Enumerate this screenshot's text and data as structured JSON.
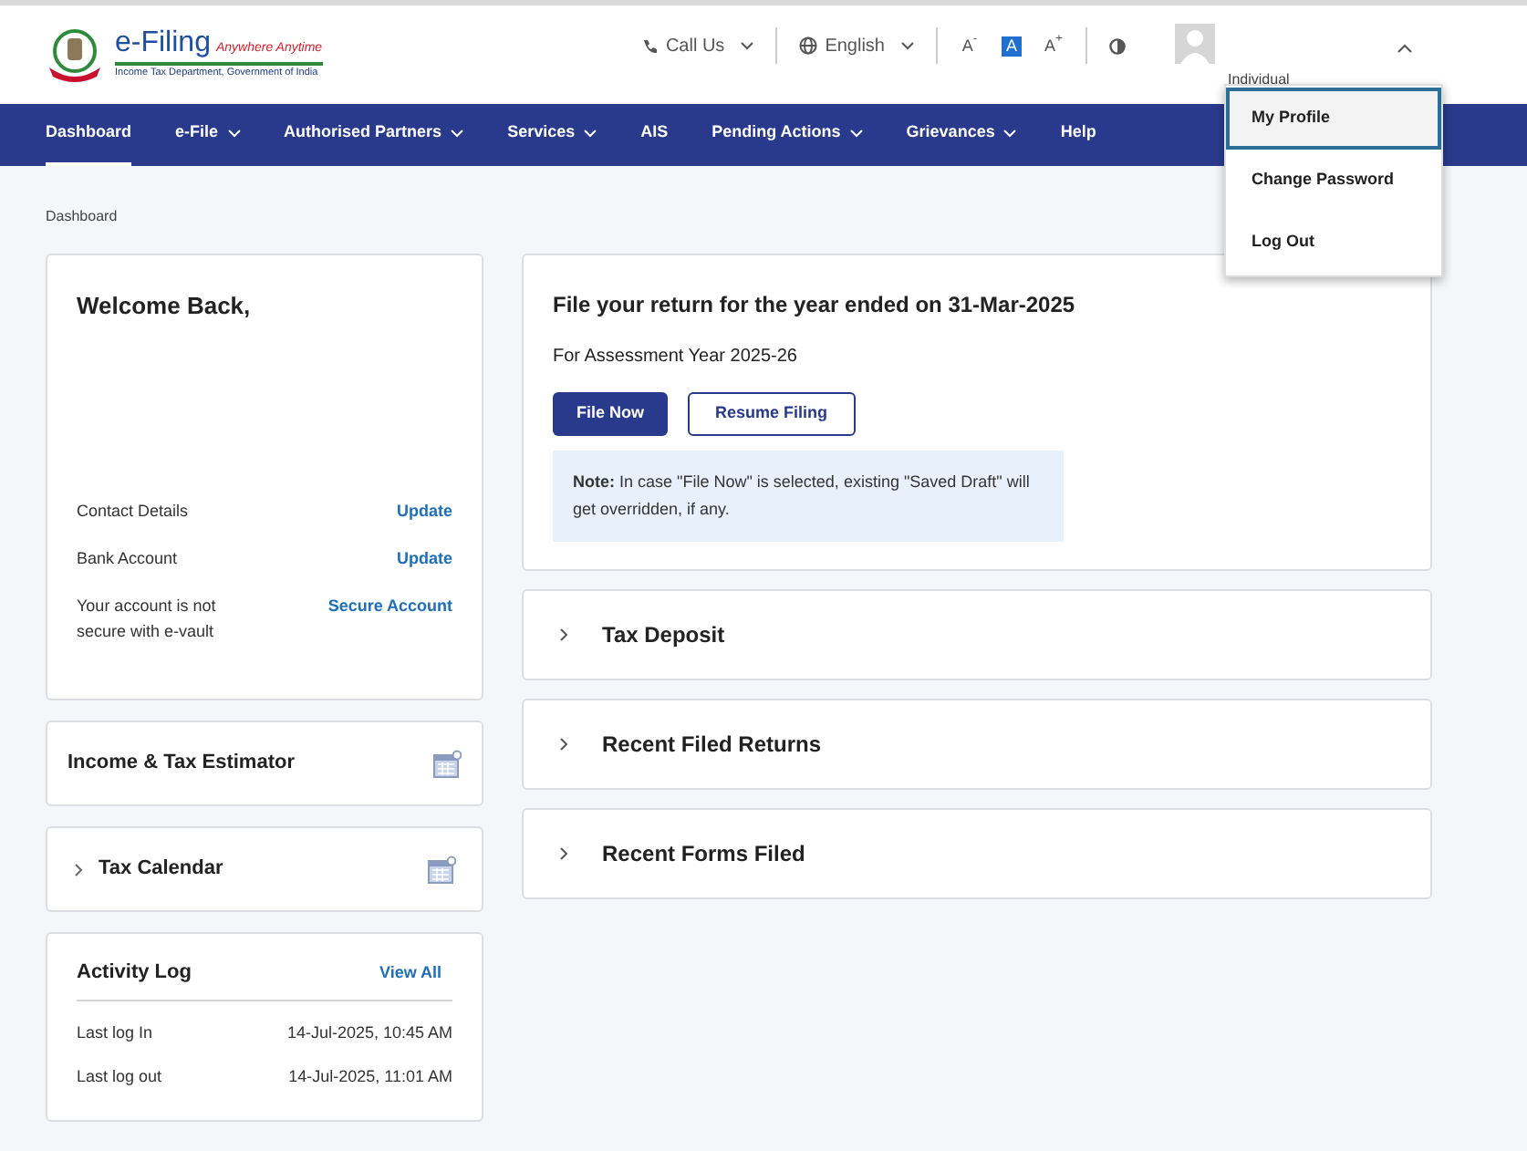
{
  "header": {
    "logo": {
      "title": "e-Filing",
      "tagline": "Anywhere Anytime",
      "subtitle": "Income Tax Department, Government of India"
    },
    "call_us": "Call Us",
    "language": "English",
    "font_sizes": [
      {
        "label": "A$^{-}$",
        "selected": false
      },
      {
        "label": "A",
        "selected": true
      },
      {
        "label": "A$^{+}$",
        "selected": false
      }
    ],
    "user_role": "Individual",
    "menu_expanded": true
  },
  "nav": [
    {
      "label": "Dashboard",
      "selected": true,
      "dropdown": false
    },
    {
      "label": "e-File",
      "selected": false,
      "dropdown": true
    },
    {
      "label": "Authorised Partners",
      "selected": false,
      "dropdown": true
    },
    {
      "label": "Services",
      "selected": false,
      "dropdown": true
    },
    {
      "label": "AIS",
      "selected": false,
      "dropdown": false
    },
    {
      "label": "Pending Actions",
      "selected": false,
      "dropdown": true
    },
    {
      "label": "Grievances",
      "selected": false,
      "dropdown": true
    },
    {
      "label": "Help",
      "selected": false,
      "dropdown": false
    }
  ],
  "user_menu": [
    {
      "label": "My Profile",
      "selected": true
    },
    {
      "label": "Change Password",
      "selected": false
    },
    {
      "label": "Log Out",
      "selected": false
    }
  ],
  "breadcrumb": "Dashboard",
  "welcome": {
    "title": "Welcome Back,",
    "rows": [
      {
        "label": "Contact Details",
        "action": "Update"
      },
      {
        "label": "Bank Account",
        "action": "Update"
      },
      {
        "label": "Your account is not secure with e-vault",
        "action": "Secure Account"
      }
    ]
  },
  "estimator": {
    "title": "Income & Tax Estimator"
  },
  "tax_calendar": {
    "title": "Tax Calendar",
    "expanded": false
  },
  "activity_log": {
    "title": "Activity Log",
    "action": "View All",
    "rows": [
      {
        "label": "Last log In",
        "value": "14-Jul-2025, 10:45 AM"
      },
      {
        "label": "Last log out",
        "value": "14-Jul-2025, 11:01 AM"
      }
    ]
  },
  "file_return": {
    "title": "File your return for the year ended on 31-Mar-2025",
    "subtitle": "For Assessment Year 2025-26",
    "primary_button": "File Now",
    "secondary_button": "Resume Filing",
    "note": "**Note:** In case \"File Now\" is selected, existing \"Saved Draft\" will get overridden, if any."
  },
  "accordions": [
    {
      "title": "Tax Deposit",
      "expanded": false
    },
    {
      "title": "Recent Filed Returns",
      "expanded": false
    },
    {
      "title": "Recent Forms Filed",
      "expanded": false
    }
  ]
}
